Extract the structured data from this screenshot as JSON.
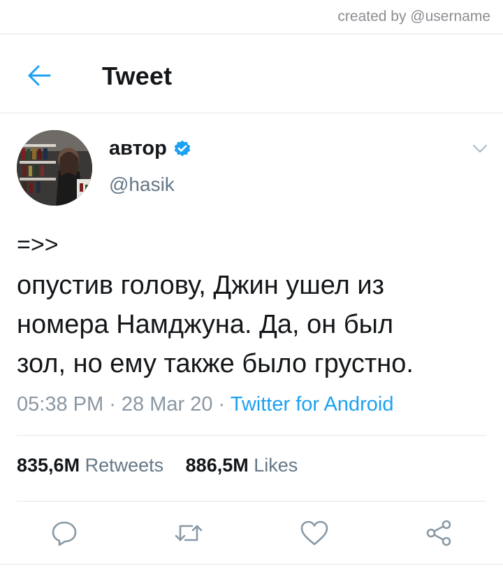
{
  "watermark": "created by @username",
  "header": {
    "title": "Tweet"
  },
  "author": {
    "name": "автор",
    "handle": "@hasik"
  },
  "tweet": {
    "lines": [
      "=>>",
      "опустив голову, Джин ушел из",
      "номера Намджуна. Да, он был",
      "зол, но ему также было грустно."
    ]
  },
  "meta": {
    "time": "05:38 PM",
    "separator": " · ",
    "date": "28 Mar 20",
    "source": "Twitter for Android"
  },
  "stats": {
    "retweets_count": "835,6M",
    "retweets_label": "Retweets",
    "likes_count": "886,5M",
    "likes_label": "Likes"
  },
  "colors": {
    "accent": "#1da1f2",
    "icon_gray": "#8899a6",
    "text": "#14171a",
    "secondary": "#657786"
  },
  "icons": {
    "back": "arrow-left-icon",
    "verified": "verified-badge-icon",
    "caret": "chevron-down-icon",
    "reply": "reply-icon",
    "retweet": "retweet-icon",
    "like": "heart-icon",
    "share": "share-icon"
  }
}
